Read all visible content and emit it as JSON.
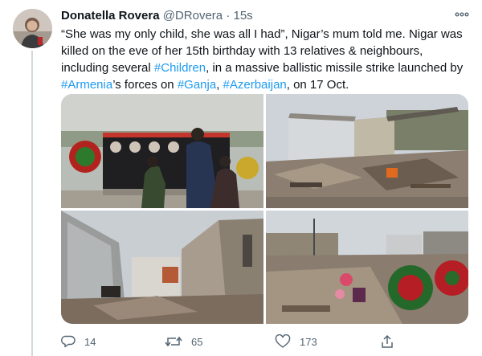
{
  "tweet": {
    "author_name": "Donatella Rovera",
    "handle": "@DRovera",
    "separator": "·",
    "timestamp": "15s",
    "text_parts": {
      "p1": "“She was my only child, she was all I had”, Nigar’s mum told me. Nigar was killed on the eve of her 15th birthday with 13 relatives & neighbours, including several ",
      "tag_children": "#Children",
      "p2": ", in a massive ballistic missile strike launched by ",
      "tag_armenia": "#Armenia",
      "p3": "’s forces on ",
      "tag_ganja": "#Ganja",
      "p4": ", ",
      "tag_azerbaijan": "#Azerbaijan",
      "p5": ", on 17 Oct."
    },
    "media": {
      "photos": [
        {
          "position": "top-left"
        },
        {
          "position": "top-right"
        },
        {
          "position": "bottom-left"
        },
        {
          "position": "bottom-right"
        }
      ]
    },
    "actions": {
      "replies": "14",
      "retweets": "65",
      "likes": "173"
    }
  },
  "colors": {
    "hashtag": "#1d9bf0",
    "secondary_text": "#536471",
    "thread_line": "#cfd9de"
  },
  "icons": [
    "more-icon",
    "reply-icon",
    "retweet-icon",
    "like-icon",
    "share-icon"
  ]
}
